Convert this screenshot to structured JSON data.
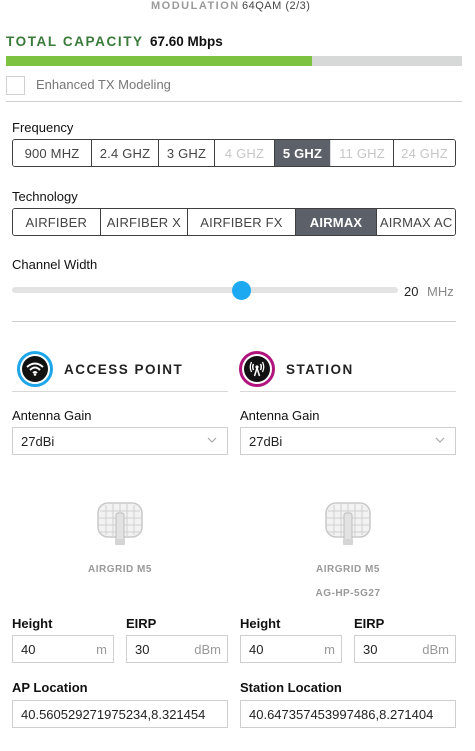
{
  "modulation": {
    "label": "MODULATION",
    "value": "64QAM (2/3)"
  },
  "capacity": {
    "label": "TOTAL CAPACITY",
    "value": "67.60 Mbps",
    "fill_percent": 67
  },
  "enhanced_tx": {
    "label": "Enhanced TX Modeling",
    "checked": false
  },
  "frequency": {
    "label": "Frequency",
    "options": [
      "900 MHZ",
      "2.4 GHZ",
      "3 GHZ",
      "4 GHZ",
      "5 GHZ",
      "11 GHZ",
      "24 GHZ"
    ],
    "selected": "5 GHZ",
    "disabled": [
      "4 GHZ",
      "11 GHZ",
      "24 GHZ"
    ]
  },
  "technology": {
    "label": "Technology",
    "options": [
      "AIRFIBER",
      "AIRFIBER X",
      "AIRFIBER FX",
      "AIRMAX",
      "AIRMAX AC"
    ],
    "selected": "AIRMAX"
  },
  "channel_width": {
    "label": "Channel Width",
    "value": "20",
    "unit": "MHz",
    "position_fraction": 0.6
  },
  "access_point": {
    "title": "ACCESS POINT",
    "icon": "wifi-icon",
    "accent": "#1ea6e8",
    "antenna_gain_label": "Antenna Gain",
    "antenna_gain": "27dBi",
    "device_name": "AIRGRID M5",
    "height_label": "Height",
    "height": "40",
    "height_unit": "m",
    "eirp_label": "EIRP",
    "eirp": "30",
    "eirp_unit": "dBm",
    "location_label": "AP Location",
    "location": "40.560529271975234,8.321454"
  },
  "station": {
    "title": "STATION",
    "icon": "antenna-tower-icon",
    "accent": "#b0157d",
    "antenna_gain_label": "Antenna Gain",
    "antenna_gain": "27dBi",
    "device_name": "AIRGRID M5",
    "device_model": "AG-HP-5G27",
    "height_label": "Height",
    "height": "40",
    "height_unit": "m",
    "eirp_label": "EIRP",
    "eirp": "30",
    "eirp_unit": "dBm",
    "location_label": "Station Location",
    "location": "40.647357453997486,8.271404"
  }
}
